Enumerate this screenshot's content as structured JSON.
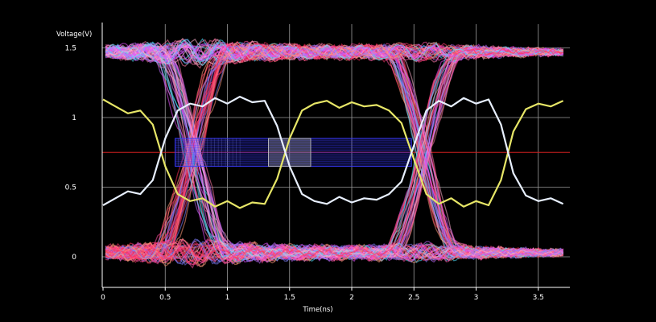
{
  "chart_data": {
    "type": "line",
    "title": "",
    "xlabel": "Time(ns)",
    "ylabel": "Voltage(V)",
    "xlim": [
      0,
      3.75
    ],
    "ylim": [
      -0.2,
      1.55
    ],
    "x_ticks": [
      0,
      0.5,
      1,
      1.5,
      2,
      2.5,
      3,
      3.5
    ],
    "x_tick_labels": [
      "0",
      "0.5",
      "1",
      "1.5",
      "2",
      "2.5",
      "3",
      "3.5"
    ],
    "y_ticks": [
      0,
      0.5,
      1,
      1.5
    ],
    "y_tick_labels": [
      "0",
      "0.5",
      "1",
      "1.5"
    ],
    "grid": true,
    "background": "#000000",
    "reference_line": {
      "y": 0.75,
      "color": "#cc1f1f"
    },
    "eye_mask": {
      "x_range": [
        0.58,
        2.48
      ],
      "y_range": [
        0.65,
        0.85
      ],
      "color": "#3a3aff"
    },
    "center_window": {
      "x_range": [
        1.33,
        1.67
      ],
      "y_range": [
        0.65,
        0.85
      ]
    },
    "crossings": [
      0.72,
      2.58
    ],
    "eye_colors": [
      "#ff3a6e",
      "#ff7aa8",
      "#ff4fa0",
      "#e84cff",
      "#7f7fff",
      "#4fe0ff",
      "#ff9a7a",
      "#ffb0d0",
      "#ff2f5a",
      "#c06bff"
    ],
    "series": [
      {
        "name": "",
        "color": "#e7e667",
        "x": [
          0,
          0.1,
          0.2,
          0.3,
          0.4,
          0.5,
          0.6,
          0.7,
          0.8,
          0.9,
          1.0,
          1.1,
          1.2,
          1.3,
          1.4,
          1.5,
          1.6,
          1.7,
          1.8,
          1.9,
          2.0,
          2.1,
          2.2,
          2.3,
          2.4,
          2.5,
          2.6,
          2.7,
          2.8,
          2.9,
          3.0,
          3.1,
          3.2,
          3.3,
          3.4,
          3.5,
          3.6,
          3.7
        ],
        "y": [
          1.13,
          1.08,
          1.03,
          1.05,
          0.95,
          0.65,
          0.45,
          0.4,
          0.42,
          0.36,
          0.4,
          0.35,
          0.39,
          0.38,
          0.56,
          0.85,
          1.05,
          1.1,
          1.12,
          1.07,
          1.11,
          1.08,
          1.09,
          1.05,
          0.96,
          0.7,
          0.45,
          0.38,
          0.42,
          0.36,
          0.4,
          0.37,
          0.55,
          0.9,
          1.06,
          1.1,
          1.08,
          1.12
        ]
      },
      {
        "name": "",
        "color": "#e8f0ff",
        "x": [
          0,
          0.1,
          0.2,
          0.3,
          0.4,
          0.5,
          0.6,
          0.7,
          0.8,
          0.9,
          1.0,
          1.1,
          1.2,
          1.3,
          1.4,
          1.5,
          1.6,
          1.7,
          1.8,
          1.9,
          2.0,
          2.1,
          2.2,
          2.3,
          2.4,
          2.5,
          2.6,
          2.7,
          2.8,
          2.9,
          3.0,
          3.1,
          3.2,
          3.3,
          3.4,
          3.5,
          3.6,
          3.7
        ],
        "y": [
          0.37,
          0.42,
          0.47,
          0.45,
          0.55,
          0.85,
          1.05,
          1.1,
          1.08,
          1.14,
          1.1,
          1.15,
          1.11,
          1.12,
          0.94,
          0.65,
          0.45,
          0.4,
          0.38,
          0.43,
          0.39,
          0.42,
          0.41,
          0.45,
          0.54,
          0.8,
          1.05,
          1.12,
          1.08,
          1.14,
          1.1,
          1.13,
          0.95,
          0.6,
          0.44,
          0.4,
          0.42,
          0.38
        ]
      }
    ]
  }
}
